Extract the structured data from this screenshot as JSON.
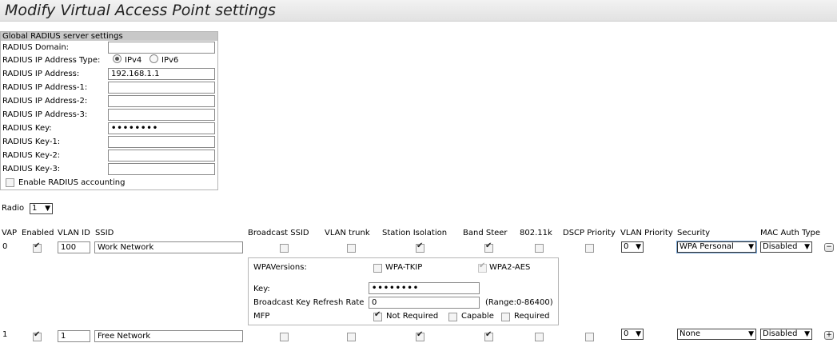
{
  "page": {
    "title": "Modify Virtual Access Point settings"
  },
  "radius": {
    "header": "Global RADIUS server settings",
    "domain_label": "RADIUS Domain:",
    "domain_value": "",
    "ip_type_label": "RADIUS IP Address Type:",
    "ipv4_label": "IPv4",
    "ipv6_label": "IPv6",
    "ip_type_selected": "IPv4",
    "ip_label": "RADIUS IP Address:",
    "ip_value": "192.168.1.1",
    "ip1_label": "RADIUS IP Address-1:",
    "ip2_label": "RADIUS IP Address-2:",
    "ip3_label": "RADIUS IP Address-3:",
    "key_label": "RADIUS Key:",
    "key_value": "••••••••",
    "key1_label": "RADIUS Key-1:",
    "key2_label": "RADIUS Key-2:",
    "key3_label": "RADIUS Key-3:",
    "accounting_label": "Enable RADIUS accounting",
    "accounting_checked": false
  },
  "radio": {
    "label": "Radio",
    "value": "1"
  },
  "table": {
    "headers": {
      "vap": "VAP",
      "enabled": "Enabled",
      "vlan_id": "VLAN ID",
      "ssid": "SSID",
      "broadcast_ssid": "Broadcast SSID",
      "vlan_trunk": "VLAN trunk",
      "station_isolation": "Station Isolation",
      "band_steer": "Band Steer",
      "dot11k": "802.11k",
      "dscp_priority": "DSCP Priority",
      "vlan_priority": "VLAN Priority",
      "security": "Security",
      "mac_auth_type": "MAC Auth Type"
    },
    "rows": [
      {
        "vap": "0",
        "enabled": true,
        "vlan_id": "100",
        "ssid": "Work Network",
        "broadcast_ssid": false,
        "vlan_trunk": false,
        "station_isolation": true,
        "band_steer": true,
        "dot11k": false,
        "dscp_priority": false,
        "vlan_priority": "0",
        "security": "WPA Personal",
        "mac_auth_type": "Disabled",
        "row_button": "−"
      },
      {
        "vap": "1",
        "enabled": true,
        "vlan_id": "1",
        "ssid": "Free Network",
        "broadcast_ssid": false,
        "vlan_trunk": false,
        "station_isolation": true,
        "band_steer": true,
        "dot11k": false,
        "dscp_priority": false,
        "vlan_priority": "0",
        "security": "None",
        "mac_auth_type": "Disabled",
        "row_button": "+"
      }
    ]
  },
  "wpa": {
    "versions_label": "WPAVersions:",
    "tkip_label": "WPA-TKIP",
    "tkip_checked": false,
    "aes_label": "WPA2-AES",
    "aes_checked": true,
    "key_label": "Key:",
    "key_value": "••••••••",
    "refresh_label": "Broadcast Key Refresh Rate",
    "refresh_value": "0",
    "refresh_range": "(Range:0-86400)",
    "mfp_label": "MFP",
    "mfp_not_required": "Not Required",
    "mfp_capable": "Capable",
    "mfp_required": "Required",
    "mfp_selected": "Not Required"
  },
  "icons": {
    "dropdown": "dropdown-arrow-icon",
    "remove": "minus-icon",
    "add": "plus-icon"
  }
}
